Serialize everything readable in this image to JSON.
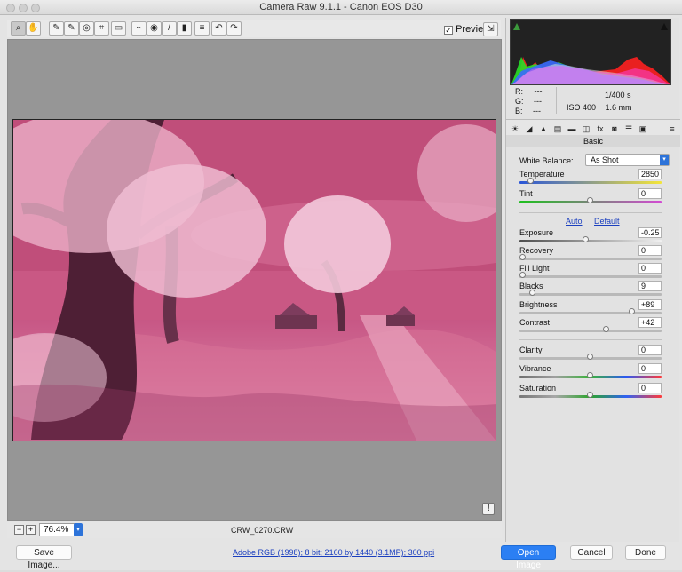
{
  "window": {
    "title": "Camera Raw 9.1.1 - Canon EOS D30"
  },
  "toolbar": {
    "tools": [
      {
        "name": "zoom-tool",
        "icon": "magnifier-icon"
      },
      {
        "name": "hand-tool",
        "icon": "hand-icon"
      },
      {
        "name": "white-balance-tool",
        "icon": "eyedropper-icon"
      },
      {
        "name": "color-sampler-tool",
        "icon": "eyedropper-plus-icon"
      },
      {
        "name": "targeted-adjustment-tool",
        "icon": "target-icon"
      },
      {
        "name": "crop-tool",
        "icon": "crop-icon"
      },
      {
        "name": "straighten-tool",
        "icon": "straighten-icon"
      },
      {
        "name": "spot-removal-tool",
        "icon": "brush-icon"
      },
      {
        "name": "red-eye-tool",
        "icon": "eye-icon"
      },
      {
        "name": "adjustment-brush-tool",
        "icon": "brush-stroke-icon"
      },
      {
        "name": "graduated-filter-tool",
        "icon": "gradient-icon"
      },
      {
        "name": "list-tool",
        "icon": "list-icon"
      },
      {
        "name": "rotate-left-tool",
        "icon": "rotate-left-icon"
      },
      {
        "name": "rotate-right-tool",
        "icon": "rotate-right-icon"
      }
    ],
    "preview_label": "Preview"
  },
  "status": {
    "zoom": "76.4%",
    "filename": "CRW_0270.CRW",
    "info": "Adobe RGB (1998); 8 bit; 2160 by 1440 (3.1MP); 300 ppi"
  },
  "buttons": {
    "save": "Save Image...",
    "open": "Open Image",
    "cancel": "Cancel",
    "done": "Done"
  },
  "panel": {
    "readout": {
      "r_label": "R:",
      "g_label": "G:",
      "b_label": "B:",
      "r_value": "---",
      "g_value": "---",
      "b_value": "---",
      "shutter": "1/400 s",
      "iso": "ISO 400",
      "focal": "1.6 mm"
    },
    "title": "Basic",
    "white_balance_label": "White Balance:",
    "white_balance_value": "As Shot",
    "auto": "Auto",
    "default": "Default",
    "controls": [
      {
        "label": "Temperature",
        "value": "2850"
      },
      {
        "label": "Tint",
        "value": "0"
      },
      {
        "label": "Exposure",
        "value": "-0.25"
      },
      {
        "label": "Recovery",
        "value": "0"
      },
      {
        "label": "Fill Light",
        "value": "0"
      },
      {
        "label": "Blacks",
        "value": "9"
      },
      {
        "label": "Brightness",
        "value": "+89"
      },
      {
        "label": "Contrast",
        "value": "+42"
      },
      {
        "label": "Clarity",
        "value": "0"
      },
      {
        "label": "Vibrance",
        "value": "0"
      },
      {
        "label": "Saturation",
        "value": "0"
      }
    ]
  },
  "colors": {
    "accent": "#2b7ff3",
    "photo_magenta": "#cf5d86",
    "histogram_bg": "#222222"
  }
}
